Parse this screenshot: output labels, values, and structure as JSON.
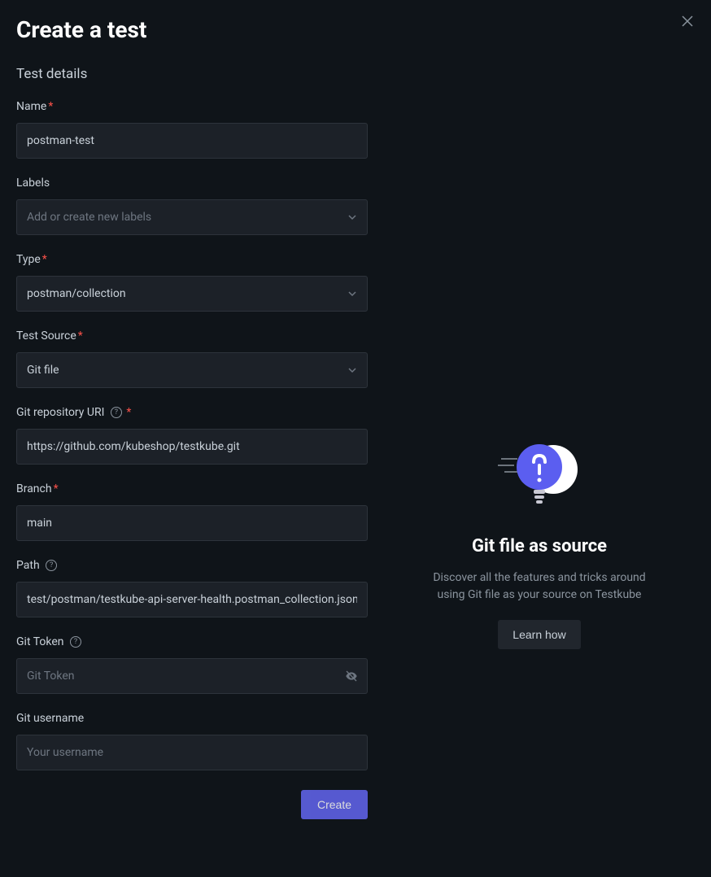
{
  "modal": {
    "title": "Create a test",
    "sectionTitle": "Test details",
    "closeLabel": "X"
  },
  "form": {
    "name": {
      "label": "Name",
      "value": "postman-test"
    },
    "labels": {
      "label": "Labels",
      "placeholder": "Add or create new labels"
    },
    "type": {
      "label": "Type",
      "value": "postman/collection"
    },
    "testSource": {
      "label": "Test Source",
      "value": "Git file"
    },
    "gitUri": {
      "label": "Git repository URI",
      "value": "https://github.com/kubeshop/testkube.git"
    },
    "branch": {
      "label": "Branch",
      "value": "main"
    },
    "path": {
      "label": "Path",
      "value": "test/postman/testkube-api-server-health.postman_collection.json"
    },
    "gitToken": {
      "label": "Git Token",
      "placeholder": "Git Token"
    },
    "gitUsername": {
      "label": "Git username",
      "placeholder": "Your username"
    },
    "createButton": "Create"
  },
  "info": {
    "title": "Git file as source",
    "description": "Discover all the features and tricks around using Git file as your source on Testkube",
    "learnButton": "Learn how"
  },
  "requiredMark": "*",
  "helpMark": "?"
}
